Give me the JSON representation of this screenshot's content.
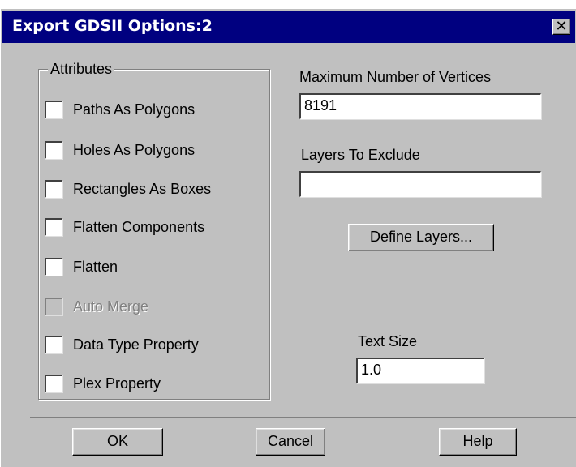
{
  "window": {
    "title": "Export GDSII Options:2",
    "close_icon": "close-icon",
    "close_glyph": "✕"
  },
  "attributes": {
    "legend": "Attributes",
    "items": [
      {
        "label": "Paths As Polygons",
        "checked": false,
        "disabled": false
      },
      {
        "label": "Holes As Polygons",
        "checked": false,
        "disabled": false
      },
      {
        "label": "Rectangles As Boxes",
        "checked": false,
        "disabled": false
      },
      {
        "label": "Flatten Components",
        "checked": false,
        "disabled": false
      },
      {
        "label": "Flatten",
        "checked": false,
        "disabled": false
      },
      {
        "label": "Auto Merge",
        "checked": false,
        "disabled": true
      },
      {
        "label": "Data Type Property",
        "checked": false,
        "disabled": false
      },
      {
        "label": "Plex Property",
        "checked": false,
        "disabled": false
      }
    ]
  },
  "max_vertices": {
    "label": "Maximum Number of Vertices",
    "value": "8191"
  },
  "layers_exclude": {
    "label": "Layers To Exclude",
    "value": ""
  },
  "define_layers_button": "Define Layers...",
  "text_size": {
    "label": "Text Size",
    "value": "1.0"
  },
  "buttons": {
    "ok": "OK",
    "cancel": "Cancel",
    "help": "Help"
  },
  "colors": {
    "titlebar": "#000080",
    "face": "#c0c0c0",
    "disabled_text": "#808080"
  }
}
